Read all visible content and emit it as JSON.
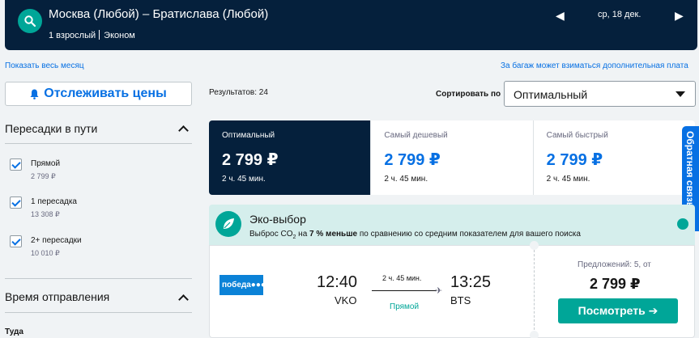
{
  "header": {
    "route": "Москва (Любой) – Братислава (Любой)",
    "passengers": "1 взрослый",
    "cabin": "Эконом",
    "date": "ср, 18 дек.",
    "prev_symbol": "◀",
    "next_symbol": "▶"
  },
  "links": {
    "show_month": "Показать весь месяц",
    "baggage": "За багаж может взиматься дополнительная плата"
  },
  "sidebar": {
    "track_prices": "Отслеживать цены",
    "stops_title": "Пересадки в пути",
    "stops": [
      {
        "label": "Прямой",
        "price": "2 799 ₽"
      },
      {
        "label": "1 пересадка",
        "price": "13 308 ₽"
      },
      {
        "label": "2+ пересадки",
        "price": "10 010 ₽"
      }
    ],
    "departure_title": "Время отправления",
    "direction": "Туда"
  },
  "results": {
    "count_label": "Результатов: 24",
    "sort_label": "Сортировать по",
    "sort_value": "Оптимальный"
  },
  "tabs": [
    {
      "name": "Оптимальный",
      "price": "2 799 ₽",
      "time": "2 ч. 45 мин."
    },
    {
      "name": "Самый дешевый",
      "price": "2 799 ₽",
      "time": "2 ч. 45 мин."
    },
    {
      "name": "Самый быстрый",
      "price": "2 799 ₽",
      "time": "2 ч. 45 мин."
    }
  ],
  "side_tab": "Обратная связь",
  "eco": {
    "title": "Эко-выбор",
    "text_prefix": "Выброс CO",
    "text_sub": "2",
    "text_mid": " на ",
    "text_bold": "7 % меньше",
    "text_suffix": " по сравнению со средним показателем для вашего поиска"
  },
  "flight": {
    "airline_logo": "победа●●●",
    "dep_time": "12:40",
    "dep_code": "VKO",
    "duration": "2 ч. 45 мин.",
    "stops": "Прямой",
    "arr_time": "13:25",
    "arr_code": "BTS",
    "offers": "Предложений: 5, от",
    "price": "2 799 ₽",
    "view_button": "Посмотреть ➔"
  },
  "colors": {
    "navy": "#05203c",
    "accent_blue": "#0770e3",
    "teal": "#00a698"
  }
}
